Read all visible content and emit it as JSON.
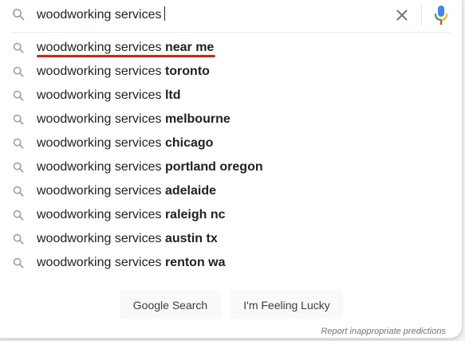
{
  "search": {
    "query": "woodworking services"
  },
  "suggestions": [
    {
      "prefix": "woodworking services ",
      "completion": "near me"
    },
    {
      "prefix": "woodworking services ",
      "completion": "toronto"
    },
    {
      "prefix": "woodworking services ",
      "completion": "ltd"
    },
    {
      "prefix": "woodworking services ",
      "completion": "melbourne"
    },
    {
      "prefix": "woodworking services ",
      "completion": "chicago"
    },
    {
      "prefix": "woodworking services ",
      "completion": "portland oregon"
    },
    {
      "prefix": "woodworking services ",
      "completion": "adelaide"
    },
    {
      "prefix": "woodworking services ",
      "completion": "raleigh nc"
    },
    {
      "prefix": "woodworking services ",
      "completion": "austin tx"
    },
    {
      "prefix": "woodworking services ",
      "completion": "renton wa"
    }
  ],
  "buttons": {
    "google_search": "Google Search",
    "feeling_lucky": "I'm Feeling Lucky"
  },
  "footer": {
    "report_link": "Report inappropriate predictions"
  },
  "icons": {
    "search": "search-icon",
    "clear": "close-icon",
    "mic": "microphone-icon",
    "suggestion": "search-icon"
  },
  "colors": {
    "text": "#202124",
    "icon_gray": "#9aa0a6",
    "annotation_red": "#d0211d",
    "mic_blue": "#4285f4",
    "mic_red": "#ea4335",
    "mic_yellow": "#fbbc04",
    "mic_green": "#34a853"
  }
}
